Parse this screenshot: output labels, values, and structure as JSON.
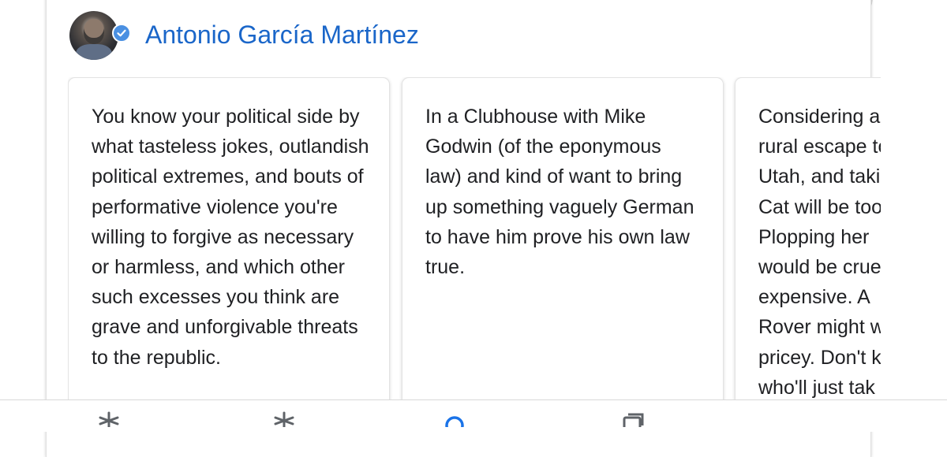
{
  "author": {
    "name": "Antonio García Martínez",
    "avatar_icon": "profile-photo",
    "verified_icon": "verified-check-icon"
  },
  "tweets": [
    {
      "text": "You know your political side by what tasteless jokes, outlandish political extremes, and bouts of performative violence you're willing to forgive as necessary or harmless, and which other such excesses you think are grave and unforgivable threats to the republic."
    },
    {
      "text": "In a Clubhouse with Mike Godwin (of the eponymous law) and kind of want to bring up something vaguely German to have him prove his own law true."
    },
    {
      "text": "Considering a rural escape to Utah, and taking Cat will be too Plopping her would be cruel expensive. A Rover might w pricey. Don't k who'll just tak"
    }
  ],
  "bottom_nav": {
    "items": [
      {
        "icon": "discover-icon"
      },
      {
        "icon": "updates-icon"
      },
      {
        "icon": "search-icon"
      },
      {
        "icon": "recent-apps-icon"
      }
    ]
  },
  "colors": {
    "link_blue": "#1a66c9",
    "verified_blue": "#4a90e2",
    "text": "#202124"
  }
}
